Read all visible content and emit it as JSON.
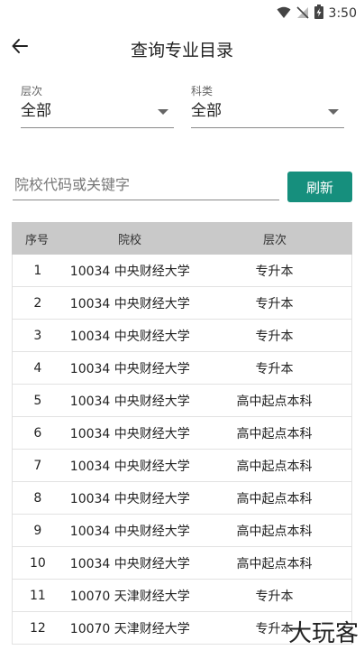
{
  "status": {
    "time": "3:50"
  },
  "header": {
    "title": "查询专业目录"
  },
  "filters": {
    "level": {
      "label": "层次",
      "value": "全部"
    },
    "category": {
      "label": "科类",
      "value": "全部"
    }
  },
  "search": {
    "placeholder": "院校代码或关键字",
    "value": ""
  },
  "refresh_label": "刷新",
  "table": {
    "headers": [
      "序号",
      "院校",
      "层次"
    ],
    "rows": [
      [
        "1",
        "10034 中央财经大学",
        "专升本"
      ],
      [
        "2",
        "10034 中央财经大学",
        "专升本"
      ],
      [
        "3",
        "10034 中央财经大学",
        "专升本"
      ],
      [
        "4",
        "10034 中央财经大学",
        "专升本"
      ],
      [
        "5",
        "10034 中央财经大学",
        "高中起点本科"
      ],
      [
        "6",
        "10034 中央财经大学",
        "高中起点本科"
      ],
      [
        "7",
        "10034 中央财经大学",
        "高中起点本科"
      ],
      [
        "8",
        "10034 中央财经大学",
        "高中起点本科"
      ],
      [
        "9",
        "10034 中央财经大学",
        "高中起点本科"
      ],
      [
        "10",
        "10034 中央财经大学",
        "高中起点本科"
      ],
      [
        "11",
        "10070 天津财经大学",
        "专升本"
      ],
      [
        "12",
        "10070 天津财经大学",
        "专升本"
      ]
    ]
  },
  "watermark": "大玩客",
  "colors": {
    "accent": "#168f7d",
    "header_bg": "#c9c9c9"
  }
}
